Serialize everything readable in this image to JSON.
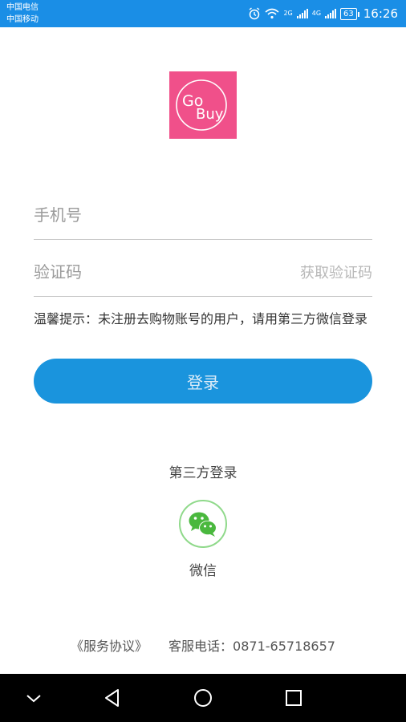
{
  "status_bar": {
    "carrier_1": "中国电信",
    "carrier_2": "中国移动",
    "signal_1": "2G",
    "signal_2": "4G",
    "battery": "63",
    "time": "16:26"
  },
  "logo": {
    "line1": "Go",
    "line2": "Buy",
    "color": "#f0508a"
  },
  "form": {
    "phone_placeholder": "手机号",
    "code_placeholder": "验证码",
    "get_code_label": "获取验证码",
    "notice": "温馨提示：未注册去购物账号的用户，请用第三方微信登录",
    "login_label": "登录"
  },
  "third_party": {
    "title": "第三方登录",
    "wechat_label": "微信"
  },
  "footer": {
    "agreement": "《服务协议》",
    "service_phone": "客服电话：0871-65718657"
  },
  "colors": {
    "accent": "#1a94dd",
    "status_bar": "#1a8ee6",
    "wechat_green": "#4ab83e"
  }
}
